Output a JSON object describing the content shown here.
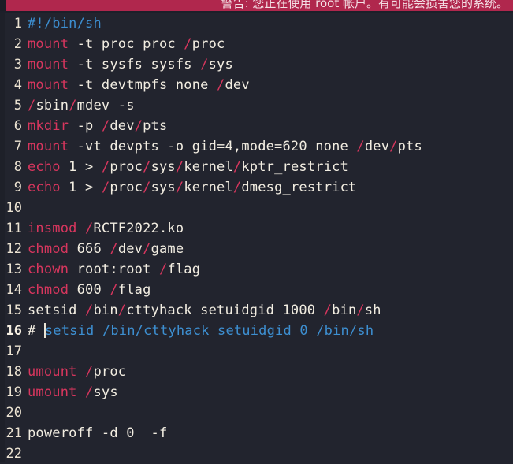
{
  "banner": {
    "name": "root-account-warning",
    "message": "警告: 您正在使用 root 帐户。有可能会损害您的系统。",
    "background_color": "#b0274d",
    "text_color": "#f3dfe4"
  },
  "editor": {
    "background_color": "#22242e",
    "gutter_color": "#1e2029",
    "line_number_color": "#ece3d2",
    "current_line": 16,
    "cursor": {
      "line": 16,
      "column": 3
    },
    "palette": {
      "plain": "#f2ede1",
      "keyword": "#d8365e",
      "separator": "#d8365e",
      "comment": "#3d8fd1",
      "shebang": "#3d8fd1"
    },
    "lines": [
      {
        "number": "1",
        "tokens": [
          {
            "t": "#!/bin/sh",
            "c": "shebang"
          }
        ]
      },
      {
        "number": "2",
        "tokens": [
          {
            "t": "mount",
            "c": "keyword"
          },
          {
            "t": " -t proc proc ",
            "c": "plain"
          },
          {
            "t": "/",
            "c": "sep"
          },
          {
            "t": "proc",
            "c": "plain"
          }
        ]
      },
      {
        "number": "3",
        "tokens": [
          {
            "t": "mount",
            "c": "keyword"
          },
          {
            "t": " -t sysfs sysfs ",
            "c": "plain"
          },
          {
            "t": "/",
            "c": "sep"
          },
          {
            "t": "sys",
            "c": "plain"
          }
        ]
      },
      {
        "number": "4",
        "tokens": [
          {
            "t": "mount",
            "c": "keyword"
          },
          {
            "t": " -t devtmpfs none ",
            "c": "plain"
          },
          {
            "t": "/",
            "c": "sep"
          },
          {
            "t": "dev",
            "c": "plain"
          }
        ]
      },
      {
        "number": "5",
        "tokens": [
          {
            "t": "/",
            "c": "sep"
          },
          {
            "t": "sbin",
            "c": "plain"
          },
          {
            "t": "/",
            "c": "sep"
          },
          {
            "t": "mdev -s",
            "c": "plain"
          }
        ]
      },
      {
        "number": "6",
        "tokens": [
          {
            "t": "mkdir",
            "c": "keyword"
          },
          {
            "t": " -p ",
            "c": "plain"
          },
          {
            "t": "/",
            "c": "sep"
          },
          {
            "t": "dev",
            "c": "plain"
          },
          {
            "t": "/",
            "c": "sep"
          },
          {
            "t": "pts",
            "c": "plain"
          }
        ]
      },
      {
        "number": "7",
        "tokens": [
          {
            "t": "mount",
            "c": "keyword"
          },
          {
            "t": " -vt devpts -o gid=4,mode=620 none ",
            "c": "plain"
          },
          {
            "t": "/",
            "c": "sep"
          },
          {
            "t": "dev",
            "c": "plain"
          },
          {
            "t": "/",
            "c": "sep"
          },
          {
            "t": "pts",
            "c": "plain"
          }
        ]
      },
      {
        "number": "8",
        "tokens": [
          {
            "t": "echo",
            "c": "keyword"
          },
          {
            "t": " 1 > ",
            "c": "plain"
          },
          {
            "t": "/",
            "c": "sep"
          },
          {
            "t": "proc",
            "c": "plain"
          },
          {
            "t": "/",
            "c": "sep"
          },
          {
            "t": "sys",
            "c": "plain"
          },
          {
            "t": "/",
            "c": "sep"
          },
          {
            "t": "kernel",
            "c": "plain"
          },
          {
            "t": "/",
            "c": "sep"
          },
          {
            "t": "kptr_restrict",
            "c": "plain"
          }
        ]
      },
      {
        "number": "9",
        "tokens": [
          {
            "t": "echo",
            "c": "keyword"
          },
          {
            "t": " 1 > ",
            "c": "plain"
          },
          {
            "t": "/",
            "c": "sep"
          },
          {
            "t": "proc",
            "c": "plain"
          },
          {
            "t": "/",
            "c": "sep"
          },
          {
            "t": "sys",
            "c": "plain"
          },
          {
            "t": "/",
            "c": "sep"
          },
          {
            "t": "kernel",
            "c": "plain"
          },
          {
            "t": "/",
            "c": "sep"
          },
          {
            "t": "dmesg_restrict",
            "c": "plain"
          }
        ]
      },
      {
        "number": "10",
        "tokens": []
      },
      {
        "number": "11",
        "tokens": [
          {
            "t": "insmod",
            "c": "keyword"
          },
          {
            "t": " ",
            "c": "plain"
          },
          {
            "t": "/",
            "c": "sep"
          },
          {
            "t": "RCTF2022.ko",
            "c": "plain"
          }
        ]
      },
      {
        "number": "12",
        "tokens": [
          {
            "t": "chmod",
            "c": "keyword"
          },
          {
            "t": " 666 ",
            "c": "plain"
          },
          {
            "t": "/",
            "c": "sep"
          },
          {
            "t": "dev",
            "c": "plain"
          },
          {
            "t": "/",
            "c": "sep"
          },
          {
            "t": "game",
            "c": "plain"
          }
        ]
      },
      {
        "number": "13",
        "tokens": [
          {
            "t": "chown",
            "c": "keyword"
          },
          {
            "t": " root:root ",
            "c": "plain"
          },
          {
            "t": "/",
            "c": "sep"
          },
          {
            "t": "flag",
            "c": "plain"
          }
        ]
      },
      {
        "number": "14",
        "tokens": [
          {
            "t": "chmod",
            "c": "keyword"
          },
          {
            "t": " 600 ",
            "c": "plain"
          },
          {
            "t": "/",
            "c": "sep"
          },
          {
            "t": "flag",
            "c": "plain"
          }
        ]
      },
      {
        "number": "15",
        "tokens": [
          {
            "t": "setsid ",
            "c": "plain"
          },
          {
            "t": "/",
            "c": "sep"
          },
          {
            "t": "bin",
            "c": "plain"
          },
          {
            "t": "/",
            "c": "sep"
          },
          {
            "t": "cttyhack setuidgid 1000 ",
            "c": "plain"
          },
          {
            "t": "/",
            "c": "sep"
          },
          {
            "t": "bin",
            "c": "plain"
          },
          {
            "t": "/",
            "c": "sep"
          },
          {
            "t": "sh",
            "c": "plain"
          }
        ]
      },
      {
        "number": "16",
        "tokens": [
          {
            "t": "# ",
            "c": "plain"
          },
          {
            "t": "CARET",
            "c": "caret"
          },
          {
            "t": "setsid /bin/cttyhack setuidgid 0 /bin/sh",
            "c": "comment"
          }
        ]
      },
      {
        "number": "17",
        "tokens": []
      },
      {
        "number": "18",
        "tokens": [
          {
            "t": "umount",
            "c": "keyword"
          },
          {
            "t": " ",
            "c": "plain"
          },
          {
            "t": "/",
            "c": "sep"
          },
          {
            "t": "proc",
            "c": "plain"
          }
        ]
      },
      {
        "number": "19",
        "tokens": [
          {
            "t": "umount",
            "c": "keyword"
          },
          {
            "t": " ",
            "c": "plain"
          },
          {
            "t": "/",
            "c": "sep"
          },
          {
            "t": "sys",
            "c": "plain"
          }
        ]
      },
      {
        "number": "20",
        "tokens": []
      },
      {
        "number": "21",
        "tokens": [
          {
            "t": "poweroff -d 0  -f",
            "c": "plain"
          }
        ]
      },
      {
        "number": "22",
        "tokens": []
      }
    ]
  }
}
